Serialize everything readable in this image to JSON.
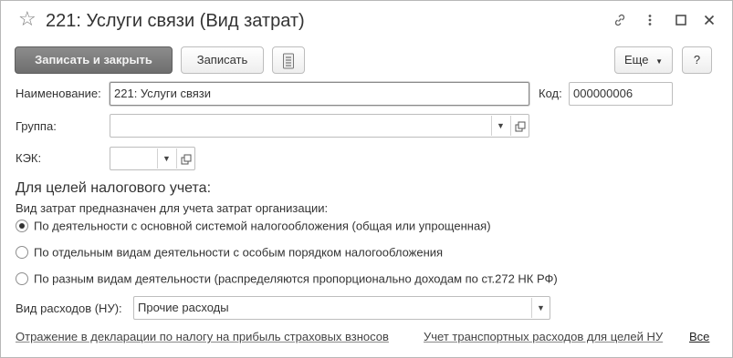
{
  "window": {
    "title": "221: Услуги связи (Вид затрат)",
    "icons": {
      "favorite": "star-icon",
      "link": "link-icon",
      "more": "more-vertical-icon",
      "maximize": "maximize-icon",
      "close": "close-icon"
    }
  },
  "toolbar": {
    "save_close_label": "Записать и закрыть",
    "save_label": "Записать",
    "list_icon": "document-list-icon",
    "more_label": "Еще",
    "help_label": "?"
  },
  "form": {
    "name_label": "Наименование:",
    "name_value": "221: Услуги связи",
    "code_label": "Код:",
    "code_value": "000000006",
    "group_label": "Группа:",
    "group_value": "",
    "kek_label": "КЭК:",
    "kek_value": ""
  },
  "tax": {
    "section_title": "Для целей налогового учета:",
    "description": "Вид затрат предназначен для учета затрат организации:",
    "options": [
      {
        "label": "По деятельности с основной системой налогообложения (общая или упрощенная)",
        "checked": true
      },
      {
        "label": "По отдельным видам деятельности с особым порядком налогообложения",
        "checked": false
      },
      {
        "label": "По разным видам деятельности (распределяются пропорционально доходам по ст.272 НК РФ)",
        "checked": false
      }
    ],
    "expense_type_label": "Вид расходов (НУ):",
    "expense_type_value": "Прочие расходы"
  },
  "footer": {
    "link1": "Отражение в декларации по налогу на прибыль страховых взносов",
    "link2": "Учет транспортных расходов для целей НУ",
    "link3": "Все"
  },
  "colors": {
    "primary_button": "#7d7d7d",
    "border": "#bdbdbd",
    "text": "#333333"
  }
}
